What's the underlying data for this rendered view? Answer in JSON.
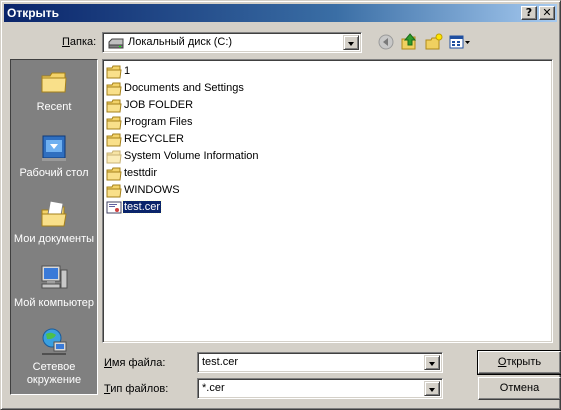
{
  "window": {
    "title": "Открыть"
  },
  "titlebar": {
    "help_label": "?",
    "close_label": "✕"
  },
  "lookin": {
    "label_u": "П",
    "label_rest": "апка:",
    "value": "Локальный диск (C:)",
    "icon": "drive-icon"
  },
  "toolbar": [
    "back-icon",
    "up-folder-icon",
    "new-folder-icon",
    "view-menu-icon"
  ],
  "places": [
    {
      "label": "Recent",
      "icon": "recent-folder-icon"
    },
    {
      "label": "Рабочий стол",
      "icon": "desktop-icon"
    },
    {
      "label": "Мои документы",
      "icon": "my-documents-icon"
    },
    {
      "label": "Мой компьютер",
      "icon": "my-computer-icon"
    },
    {
      "label": "Сетевое окружение",
      "icon": "network-icon"
    }
  ],
  "files": [
    {
      "name": "1",
      "icon": "folder-icon"
    },
    {
      "name": "Documents and Settings",
      "icon": "folder-icon"
    },
    {
      "name": "JOB FOLDER",
      "icon": "folder-icon"
    },
    {
      "name": "Program Files",
      "icon": "folder-icon"
    },
    {
      "name": "RECYCLER",
      "icon": "folder-icon"
    },
    {
      "name": "System Volume Information",
      "icon": "folder-icon"
    },
    {
      "name": "testtdir",
      "icon": "folder-icon"
    },
    {
      "name": "WINDOWS",
      "icon": "folder-icon"
    },
    {
      "name": "test.cer",
      "icon": "certificate-icon",
      "selected": true
    }
  ],
  "filename": {
    "label_u": "И",
    "label_rest": "мя файла:",
    "value": "test.cer"
  },
  "filetype": {
    "label_u": "Т",
    "label_rest": "ип файлов:",
    "value": "*.cer"
  },
  "buttons": {
    "open_u": "О",
    "open_rest": "ткрыть",
    "cancel": "Отмена"
  },
  "colors": {
    "title_start": "#0a246a",
    "title_end": "#a6caf0",
    "face": "#d4d0c8",
    "selection": "#0a246a"
  }
}
